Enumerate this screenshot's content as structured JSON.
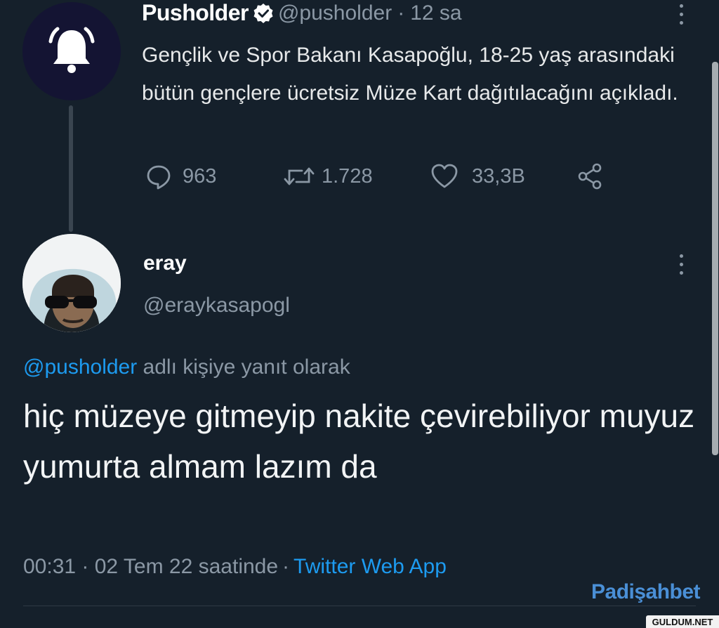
{
  "parent_tweet": {
    "author_name": "Pusholder",
    "handle": "@pusholder",
    "separator": "·",
    "time": "12 sa",
    "text": "Gençlik ve Spor Bakanı Kasapoğlu, 18-25 yaş arasındaki bütün gençlere ücretsiz Müze Kart dağıtılacağını açıkladı.",
    "replies": "963",
    "retweets": "1.728",
    "likes": "33,3B",
    "avatar_icon": "bell-icon"
  },
  "reply_tweet": {
    "author_name": "eray",
    "handle": "@eraykasapogl",
    "reply_to_mention": "@pusholder",
    "reply_to_suffix": " adlı kişiye yanıt olarak",
    "text": "hiç müzeye gitmeyip nakite çevirebiliyor muyuz yumurta almam lazım da",
    "timestamp": "00:31 · 02 Tem 22 saatinde",
    "separator": "·",
    "source_app": "Twitter Web App"
  },
  "watermarks": {
    "padisahbet": "Padişahbet",
    "guldum": "GULDUM.NET"
  },
  "colors": {
    "background": "#15202b",
    "link": "#1d9bf0",
    "muted": "#8b98a5",
    "verified": "#ffffff"
  }
}
